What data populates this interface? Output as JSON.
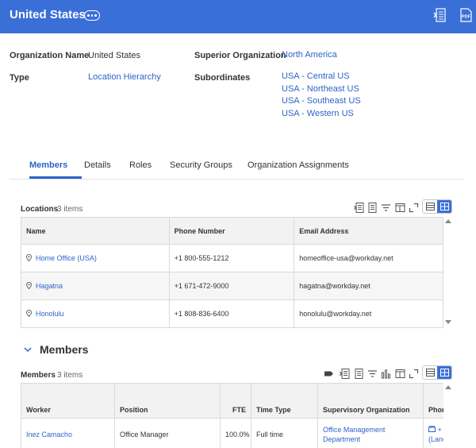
{
  "header": {
    "title": "United States",
    "more_icon": "more-icon",
    "export_excel_icon": "export-excel-icon",
    "export_pdf_icon": "export-pdf-icon",
    "accent_color": "#3b6fd8"
  },
  "details": {
    "org_name_label": "Organization Name",
    "org_name_value": "United States",
    "type_label": "Type",
    "type_value": "Location Hierarchy",
    "superior_label": "Superior Organization",
    "superior_value": "North America",
    "subordinates_label": "Subordinates",
    "subordinates": [
      "USA - Central US",
      "USA - Northeast US",
      "USA - Southeast US",
      "USA - Western US"
    ]
  },
  "tabs": [
    "Members",
    "Details",
    "Roles",
    "Security Groups",
    "Organization Assignments"
  ],
  "active_tab": "Members",
  "locations": {
    "title": "Locations",
    "count": "3 items",
    "columns": [
      "Name",
      "Phone Number",
      "Email Address"
    ],
    "rows": [
      {
        "name": "Home Office (USA)",
        "phone": "+1 800-555-1212",
        "email": "homeoffice-usa@workday.net"
      },
      {
        "name": "Hagatna",
        "phone": "+1 671-472-9000",
        "email": "hagatna@workday.net"
      },
      {
        "name": "Honolulu",
        "phone": "+1 808-836-6400",
        "email": "honolulu@workday.net"
      }
    ]
  },
  "members_section": {
    "title": "Members"
  },
  "members": {
    "title": "Members",
    "count": "3 items",
    "columns": [
      "Worker",
      "Position",
      "FTE",
      "Time Type",
      "Supervisory Organization",
      "Phon"
    ],
    "rows": [
      {
        "worker": "Inez Camacho",
        "position": "Office Manager",
        "fte": "100.0%",
        "time_type": "Full time",
        "sup_org_line1": "Office Management",
        "sup_org_line2": "Department",
        "phone_line1": "+",
        "phone_line2": "(Lanc"
      }
    ]
  }
}
